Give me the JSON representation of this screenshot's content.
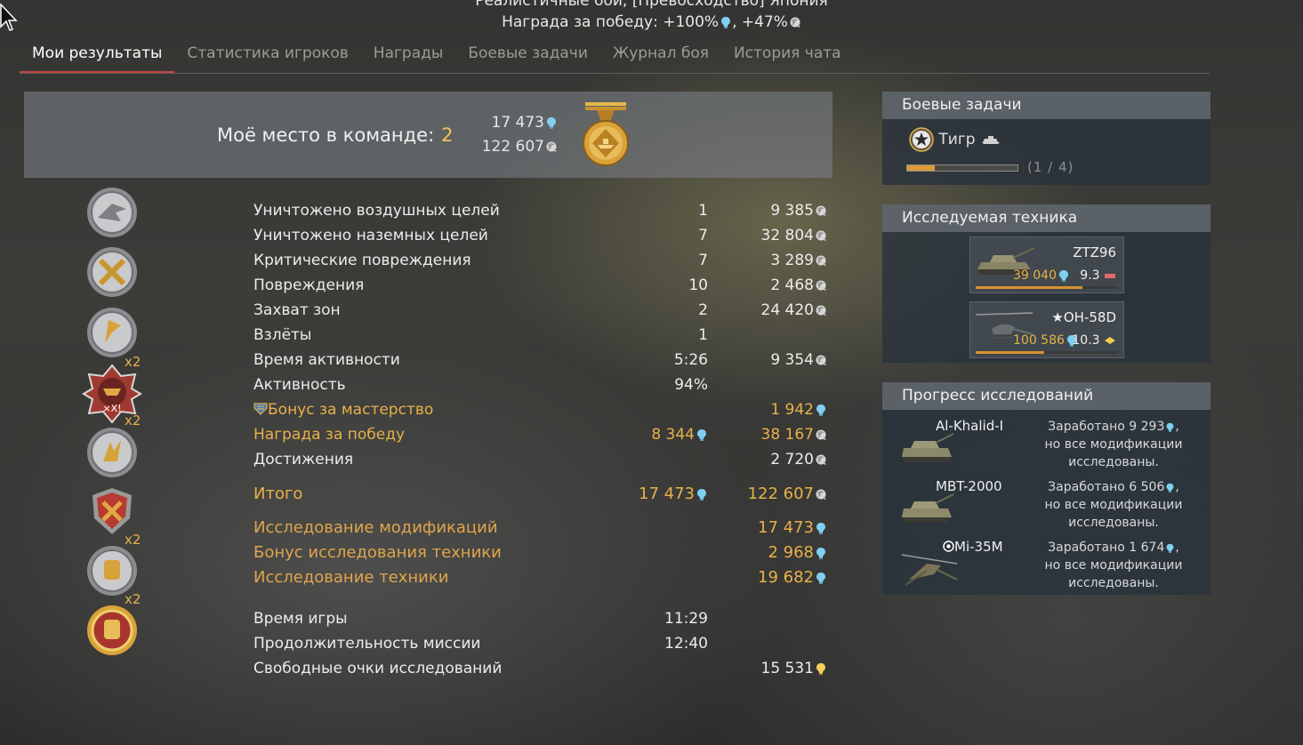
{
  "header": {
    "mode_line": "Реалистичные бои, [Превосходство] Япония",
    "reward_line": "Награда за победу: +100%",
    "reward_line_b": ", +47%"
  },
  "tabs": [
    {
      "label": "Мои результаты",
      "active": true
    },
    {
      "label": "Статистика игроков"
    },
    {
      "label": "Награды"
    },
    {
      "label": "Боевые задачи"
    },
    {
      "label": "Журнал боя"
    },
    {
      "label": "История чата"
    }
  ],
  "rank": {
    "label": "Моё место в команде:",
    "place": "2",
    "rp": "17 473",
    "sl": "122 607"
  },
  "rows": [
    {
      "label": "Уничтожено воздушных целей",
      "count": "1",
      "sl": "9 385"
    },
    {
      "label": "Уничтожено наземных целей",
      "count": "7",
      "sl": "32 804"
    },
    {
      "label": "Критические повреждения",
      "count": "7",
      "sl": "3 289"
    },
    {
      "label": "Повреждения",
      "count": "10",
      "sl": "2 468"
    },
    {
      "label": "Захват зон",
      "count": "2",
      "sl": "24 420"
    },
    {
      "label": "Взлёты",
      "count": "1",
      "sl": ""
    },
    {
      "label": "Время активности",
      "count": "5:26",
      "sl": "9 354"
    },
    {
      "label": "Активность",
      "count": "94%",
      "sl": ""
    }
  ],
  "mastery": {
    "label": "Бонус за мастерство",
    "rp": "1 942"
  },
  "victory": {
    "label": "Награда за победу",
    "rp": "8 344",
    "sl": "38 167"
  },
  "achievements": {
    "label": "Достижения",
    "sl": "2 720"
  },
  "total": {
    "label": "Итого",
    "rp": "17 473",
    "sl": "122 607"
  },
  "research": [
    {
      "label": "Исследование модификаций",
      "value": "17 473"
    },
    {
      "label": "Бонус исследования техники",
      "value": "2 968"
    },
    {
      "label": "Исследование техники",
      "value": "19 682"
    }
  ],
  "times": [
    {
      "label": "Время игры",
      "value": "11:29"
    },
    {
      "label": "Продолжительность миссии",
      "value": "12:40"
    }
  ],
  "free_rp": {
    "label": "Свободные очки исследований",
    "value": "15 531"
  },
  "awards": {
    "multiplier": "x2",
    "banner": "×X!"
  },
  "tasks_panel": {
    "title": "Боевые задачи",
    "task_name": "Тигр",
    "progress": "(1 / 4)",
    "progress_fraction": 0.25
  },
  "research_panel": {
    "title": "Исследуемая техника",
    "vehicles": [
      {
        "name": "ZTZ96",
        "rp": "39 040",
        "br": "9.3",
        "fill": 0.75
      },
      {
        "name": "★OH-58D",
        "rp": "100 586",
        "br": "10.3",
        "fill": 0.48
      }
    ]
  },
  "progress_panel": {
    "title": "Прогресс исследований",
    "items": [
      {
        "name": "Al-Khalid-I",
        "earned": "Заработано 9 293",
        "note": "но все модификации исследованы."
      },
      {
        "name": "MBT-2000",
        "earned": "Заработано 6 506",
        "note": "но все модификации исследованы."
      },
      {
        "name": "Mi-35M",
        "earned": "Заработано 1 674",
        "note": "но все модификации исследованы."
      }
    ]
  },
  "colors": {
    "gold": "#e8b14a",
    "rp_blue": "#7fd0f0",
    "tab_accent": "#c7453b"
  },
  "icons": {
    "rp": "research-points-icon",
    "sl": "silver-lions-icon",
    "free_rp": "free-rp-icon"
  }
}
